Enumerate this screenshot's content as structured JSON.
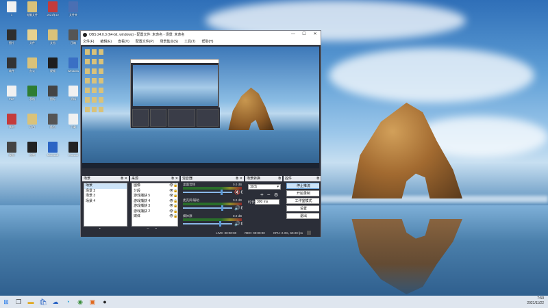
{
  "desktop": {
    "icons": [
      {
        "label": "1",
        "color": "#f1f1f1"
      },
      {
        "label": "电脑文件",
        "color": "#d9c27a"
      },
      {
        "label": "2021年10",
        "color": "#c43b3b"
      },
      {
        "label": "文件夹",
        "color": "#4a6fb3"
      },
      {
        "label": "图片",
        "color": "#2e2e2e"
      },
      {
        "label": "文件",
        "color": "#e6d18f"
      },
      {
        "label": "文档",
        "color": "#d9c27a"
      },
      {
        "label": "压缩",
        "color": "#555"
      },
      {
        "label": "软件",
        "color": "#333"
      },
      {
        "label": "办公",
        "color": "#d9c27a"
      },
      {
        "label": "视频",
        "color": "#1e1e1e"
      },
      {
        "label": "Windows",
        "color": "#3a6fc4"
      },
      {
        "label": "PDF",
        "color": "#f1f1f1"
      },
      {
        "label": "表格",
        "color": "#2e7d32"
      },
      {
        "label": "图标",
        "color": "#444"
      },
      {
        "label": "资料",
        "color": "#f1f1f1"
      },
      {
        "label": "素材",
        "color": "#c43b3b"
      },
      {
        "label": "项目",
        "color": "#d9c27a"
      },
      {
        "label": "备份",
        "color": "#555"
      },
      {
        "label": "下载",
        "color": "#f1f1f1"
      },
      {
        "label": "桌面",
        "color": "#444"
      },
      {
        "label": "设置",
        "color": "#222"
      },
      {
        "label": "Microsoft",
        "color": "#2b64c4"
      },
      {
        "label": "Chrome",
        "color": "#222"
      }
    ]
  },
  "obs": {
    "title": "OBS 24.0.3 (64-bit, windows) - 配置文件: 未命名 - 场景: 未命名",
    "menu": [
      "文件(F)",
      "编辑(E)",
      "查看(V)",
      "配置文件(P)",
      "场景集合(S)",
      "工具(T)",
      "帮助(H)"
    ],
    "docks": {
      "scenes": {
        "title": "场景",
        "items": [
          "场景",
          "场景 2",
          "场景 3",
          "场景 4"
        ],
        "selected": 0
      },
      "sources": {
        "title": "来源",
        "items": [
          "图像",
          "分段",
          "游戏捕获 5",
          "游戏捕获 4",
          "游戏捕获 3",
          "游戏捕获 2",
          "媒体"
        ]
      },
      "mixer": {
        "title": "混音器",
        "tracks": [
          {
            "name": "桌面音频",
            "value": "0.0 dB",
            "level": 0.78,
            "muted": true
          },
          {
            "name": "麦克风/辅助",
            "value": "0.0 dB",
            "level": 0.8,
            "muted": false
          },
          {
            "name": "媒体源",
            "value": "0.0 dB",
            "level": 0.75,
            "muted": false
          }
        ]
      },
      "transitions": {
        "title": "场景转换",
        "selected": "淡出",
        "duration_label": "时长",
        "duration": "300 ms"
      },
      "controls": {
        "title": "控件",
        "buttons": [
          "停止推流",
          "开始录制",
          "工作室模式",
          "设置",
          "退出"
        ]
      }
    },
    "status": {
      "live": "LIVE: 00:00:00",
      "rec": "REC: 00:00:00",
      "cpu": "CPU: 2.3%, 60.00 fps"
    }
  },
  "taskbar": {
    "apps": [
      "start-icon",
      "task-view-icon",
      "store-icon",
      "cloud-icon",
      "file-explorer-icon",
      "edge-icon",
      "chrome-icon",
      "obs-icon"
    ],
    "time": "7:50",
    "date": "2021/11/22"
  }
}
